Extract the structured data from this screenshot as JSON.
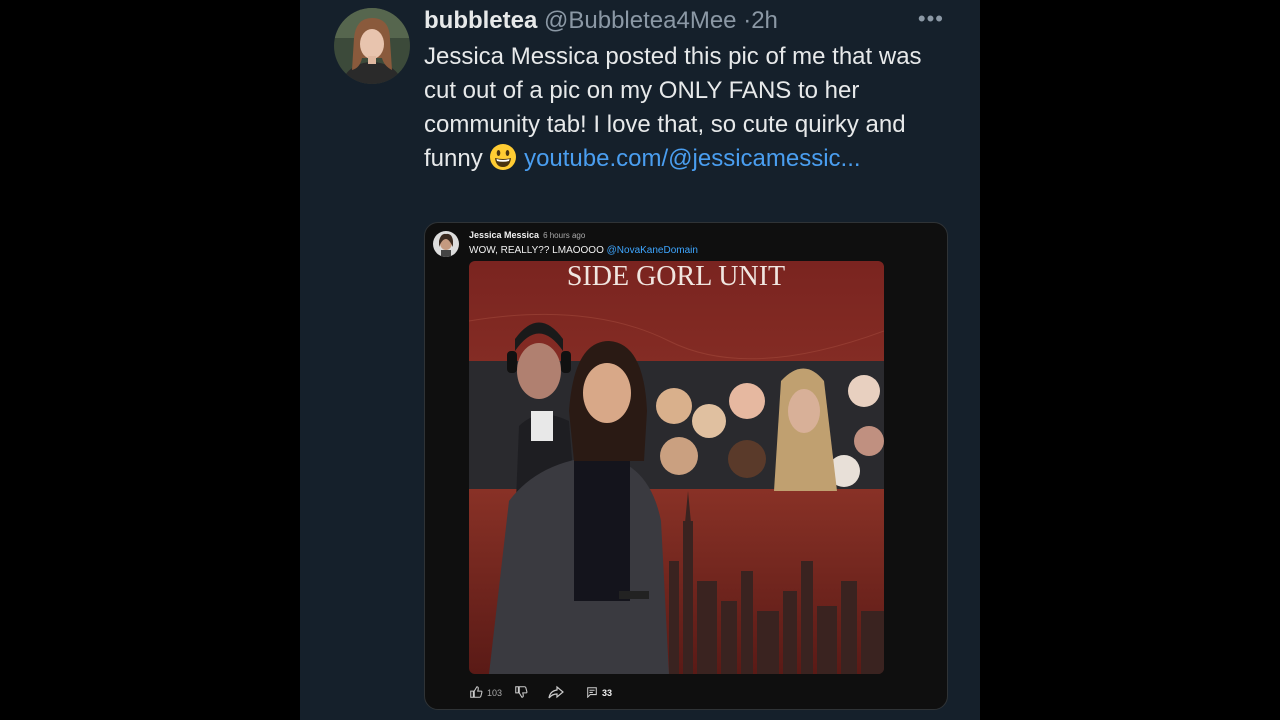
{
  "tweet": {
    "display_name": "bubbletea",
    "handle": "@Bubbletea4Mee",
    "separator": "·",
    "time": "2h",
    "more_label": "•••",
    "text": "Jessica Messica posted this pic of me that was cut out of a pic on my ONLY FANS to her community tab! I love that, so cute quirky and funny ",
    "emoji_name": "grinning-face-emoji",
    "link_text": "youtube.com/@jessicamessic..."
  },
  "embedded_post": {
    "author": "Jessica Messica",
    "time": "6 hours ago",
    "text": "WOW, REALLY?? LMAOOOO ",
    "mention": "@NovaKaneDomain",
    "image": {
      "title": "SIDE GORL UNIT",
      "description_icon": "poster-image"
    },
    "like_count": "103",
    "comment_count": "33",
    "icons": [
      "thumbs-up-icon",
      "thumbs-down-icon",
      "share-icon",
      "comment-icon"
    ]
  },
  "colors": {
    "background": "#15202b",
    "text": "#e7e9ea",
    "muted": "#8b98a5",
    "link": "#4a9ef0",
    "mention": "#3ea6ff"
  }
}
